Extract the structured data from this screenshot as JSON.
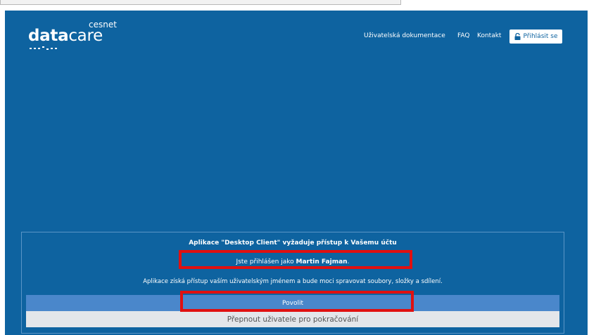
{
  "logo": {
    "brand_bold": "data",
    "brand_rest": "care",
    "sub": "cesnet"
  },
  "nav": {
    "docs": "Uživatelská dokumentace",
    "faq": "FAQ",
    "contact": "Kontakt",
    "login": "Přihlásit se"
  },
  "consent": {
    "title": "Aplikace \"Desktop Client\" vyžaduje přístup k Vašemu účtu",
    "logged_prefix": "Jste přihlášen jako ",
    "user_name": "Martin Fajman",
    "logged_suffix": ".",
    "description": "Aplikace získá přístup vaším uživatelským jménem a bude moci spravovat soubory, složky a sdílení.",
    "allow": "Povolit",
    "switch_user": "Přepnout uživatele pro pokračování"
  },
  "colors": {
    "background": "#0e63a0",
    "allow_button": "#4a87cb",
    "switch_button": "#e3e6ea",
    "highlight": "#e01010"
  },
  "icons": {
    "login": "lock-icon",
    "logo_dots": "dots-icon"
  }
}
